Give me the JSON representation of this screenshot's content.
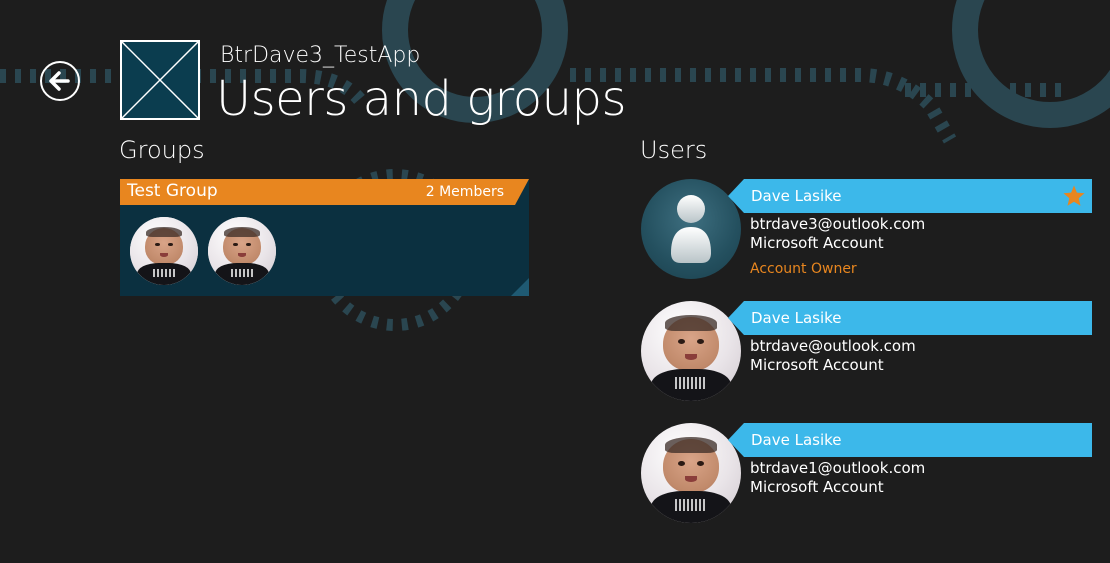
{
  "header": {
    "app_name": "BtrDave3_TestApp",
    "page_title": "Users and groups"
  },
  "icons": {
    "back": "back-arrow-icon",
    "app_logo": "placeholder-logo-icon",
    "owner_star": "star-icon"
  },
  "groups": {
    "title": "Groups",
    "items": [
      {
        "name": "Test Group",
        "member_count": "2 Members"
      }
    ]
  },
  "users": {
    "title": "Users",
    "items": [
      {
        "name": "Dave Lasike",
        "email": "btrdave3@outlook.com",
        "account_type": "Microsoft Account",
        "role": "Account Owner"
      },
      {
        "name": "Dave Lasike",
        "email": "btrdave@outlook.com",
        "account_type": "Microsoft Account"
      },
      {
        "name": "Dave Lasike",
        "email": "btrdave1@outlook.com",
        "account_type": "Microsoft Account"
      }
    ]
  },
  "colors": {
    "background": "#1d1d1d",
    "group_header": "#e8861f",
    "group_tile": "#0b3040",
    "user_name_bar": "#3cb8ea",
    "owner_role": "#e8861f"
  }
}
